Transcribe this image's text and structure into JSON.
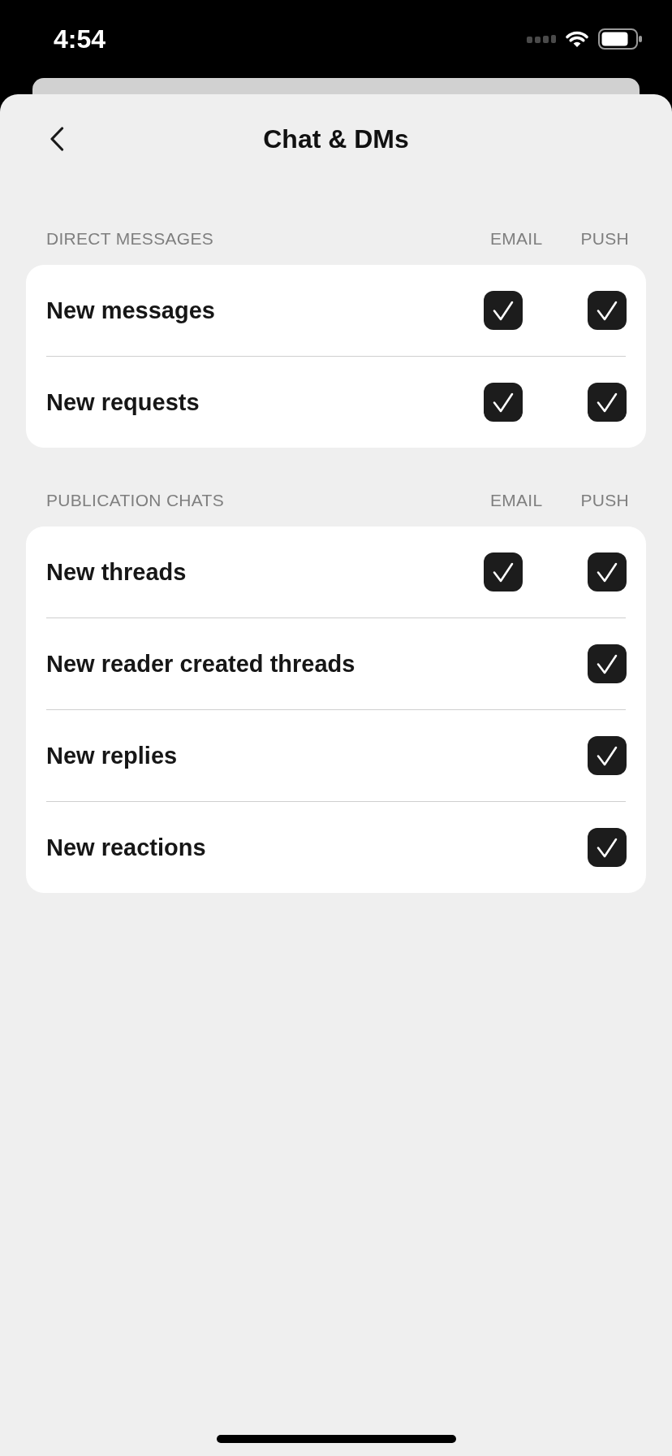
{
  "status_bar": {
    "time": "4:54"
  },
  "header": {
    "title": "Chat & DMs"
  },
  "sections": [
    {
      "title": "DIRECT MESSAGES",
      "columns": [
        "EMAIL",
        "PUSH"
      ],
      "rows": [
        {
          "label": "New messages",
          "email_checked": true,
          "push_checked": true
        },
        {
          "label": "New requests",
          "email_checked": true,
          "push_checked": true
        }
      ]
    },
    {
      "title": "PUBLICATION CHATS",
      "columns": [
        "EMAIL",
        "PUSH"
      ],
      "rows": [
        {
          "label": "New threads",
          "email_checked": true,
          "push_checked": true
        },
        {
          "label": "New reader created threads",
          "push_checked": true
        },
        {
          "label": "New replies",
          "push_checked": true
        },
        {
          "label": "New reactions",
          "push_checked": true
        }
      ]
    }
  ]
}
